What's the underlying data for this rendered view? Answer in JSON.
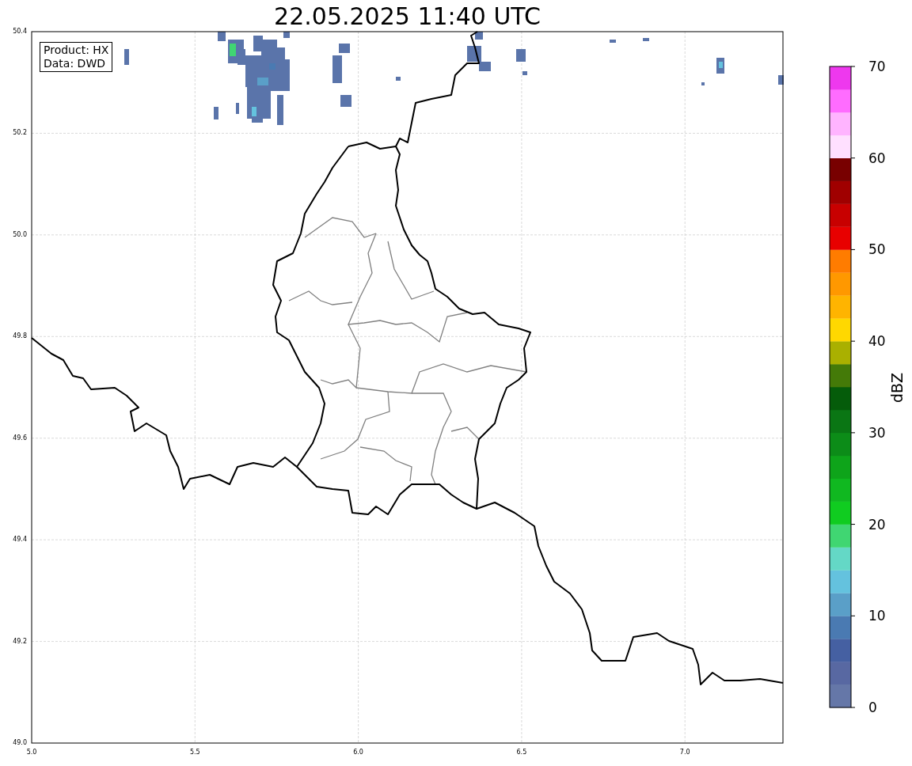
{
  "title": "22.05.2025 11:40 UTC",
  "info_box": {
    "lines": [
      "Product: HX",
      "Data: DWD"
    ]
  },
  "map": {
    "xticks": [
      "5.0",
      "5.5",
      "6.0",
      "6.5",
      "7.0"
    ],
    "yticks": [
      "50.4",
      "50.2",
      "50.0",
      "49.8",
      "49.6",
      "49.4",
      "49.2",
      "49.0"
    ]
  },
  "colorbar": {
    "label": "dBZ",
    "ticks": [
      "70",
      "60",
      "50",
      "40",
      "30",
      "20",
      "10",
      "0"
    ],
    "bins": [
      {
        "color": "#6577a8"
      },
      {
        "color": "#5868a2"
      },
      {
        "color": "#4560a2"
      },
      {
        "color": "#4a7ab2"
      },
      {
        "color": "#5a9fc8"
      },
      {
        "color": "#64c2de"
      },
      {
        "color": "#64d8c6"
      },
      {
        "color": "#40d672"
      },
      {
        "color": "#10cc20"
      },
      {
        "color": "#10b820"
      },
      {
        "color": "#0ea41a"
      },
      {
        "color": "#0c8c18"
      },
      {
        "color": "#0a7614"
      },
      {
        "color": "#055c0a"
      },
      {
        "color": "#447a08"
      },
      {
        "color": "#aab000"
      },
      {
        "color": "#ffd800"
      },
      {
        "color": "#ffb400"
      },
      {
        "color": "#ff9800"
      },
      {
        "color": "#ff7c00"
      },
      {
        "color": "#e80000"
      },
      {
        "color": "#c80000"
      },
      {
        "color": "#a00000"
      },
      {
        "color": "#780000"
      },
      {
        "color": "#ffe0ff"
      },
      {
        "color": "#ffb4ff"
      },
      {
        "color": "#ff6cff"
      },
      {
        "color": "#ee38ee"
      }
    ]
  }
}
